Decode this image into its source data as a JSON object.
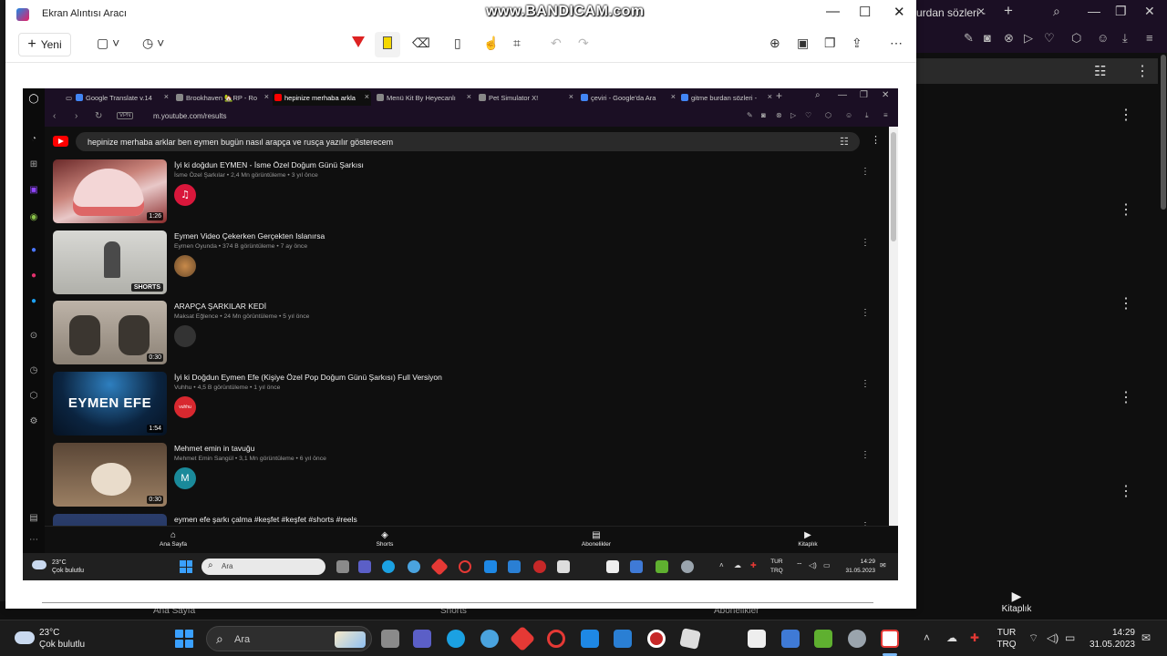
{
  "bg_browser": {
    "tab_title": "urdan sözleri -",
    "bottom_nav": [
      "Ana Sayfa",
      "Shorts",
      "Abonelikler"
    ],
    "library_label": "Kitaplık"
  },
  "watermark": "www.BANDICAM.com",
  "snipping_tool": {
    "title": "Ekran Alıntısı Aracı",
    "new_button": "Yeni"
  },
  "inner_browser": {
    "tabs": [
      {
        "label": "Google Translate v.14",
        "color": "#4285f4",
        "active": false
      },
      {
        "label": "Brookhaven 🏡RP - Ro",
        "color": "#888888",
        "active": false
      },
      {
        "label": "hepinize merhaba arkla",
        "color": "#ff0000",
        "active": true
      },
      {
        "label": "Menü Kit By Heyecanlı",
        "color": "#888888",
        "active": false
      },
      {
        "label": "Pet Simulator X!",
        "color": "#888888",
        "active": false
      },
      {
        "label": "çeviri - Google'da Ara",
        "color": "#4285f4",
        "active": false
      },
      {
        "label": "gitme burdan sözleri -",
        "color": "#4285f4",
        "active": false
      }
    ],
    "vpn_label": "VPN",
    "url": "m.youtube.com/results",
    "search_query": "hepinize merhaba arklar ben eymen bugün nasıl arapça ve rusça yazılır gösterecem"
  },
  "results": [
    {
      "title": "İyi ki doğdun EYMEN - İsme Özel Doğum Günü Şarkısı",
      "channel": "İsme Özel Şarkılar",
      "views": "2,4 Mn görüntüleme",
      "age": "3 yıl önce",
      "duration": "1:26",
      "avatar_text": "♫"
    },
    {
      "title": "Eymen Video Çekerken Gerçekten Islanırsa",
      "channel": "Eymen Oyunda",
      "views": "374 B görüntüleme",
      "age": "7 ay önce",
      "duration": "SHORTS",
      "avatar_text": ""
    },
    {
      "title": "ARAPÇA ŞARKILAR KEDİ",
      "channel": "Maksat Eğlence",
      "views": "24 Mn görüntüleme",
      "age": "5 yıl önce",
      "duration": "0:30",
      "avatar_text": ""
    },
    {
      "title": "İyi ki Doğdun Eymen Efe (Kişiye Özel Pop Doğum Günü Şarkısı) Full Versiyon",
      "channel": "Vuhhu",
      "views": "4,5 B görüntüleme",
      "age": "1 yıl önce",
      "duration": "1:54",
      "avatar_text": "vuhhu",
      "thumb_text": "EYMEN EFE"
    },
    {
      "title": "Mehmet emin in tavuğu",
      "channel": "Mehmet Emin Sangül",
      "views": "3,1 Mn görüntüleme",
      "age": "6 yıl önce",
      "duration": "0:30",
      "avatar_text": "M"
    },
    {
      "title": "eymen efe şarkı çalma #keşfet #keşfet #shorts #reels",
      "channel": "",
      "views": "",
      "age": "",
      "duration": "",
      "avatar_text": ""
    }
  ],
  "yt_bottom_nav": [
    {
      "label": "Ana Sayfa",
      "icon": "home-icon"
    },
    {
      "label": "Shorts",
      "icon": "shorts-icon"
    },
    {
      "label": "Abonelikler",
      "icon": "subscriptions-icon"
    },
    {
      "label": "Kitaplık",
      "icon": "library-icon"
    }
  ],
  "inner_taskbar": {
    "temp": "23°C",
    "weather": "Çok bulutlu",
    "search_placeholder": "Ara",
    "lang1": "TUR",
    "lang2": "TRQ",
    "time": "14:29",
    "date": "31.05.2023"
  },
  "taskbar": {
    "temp": "23°C",
    "weather": "Çok bulutlu",
    "search_placeholder": "Ara",
    "lang1": "TUR",
    "lang2": "TRQ",
    "time": "14:29",
    "date": "31.05.2023"
  }
}
